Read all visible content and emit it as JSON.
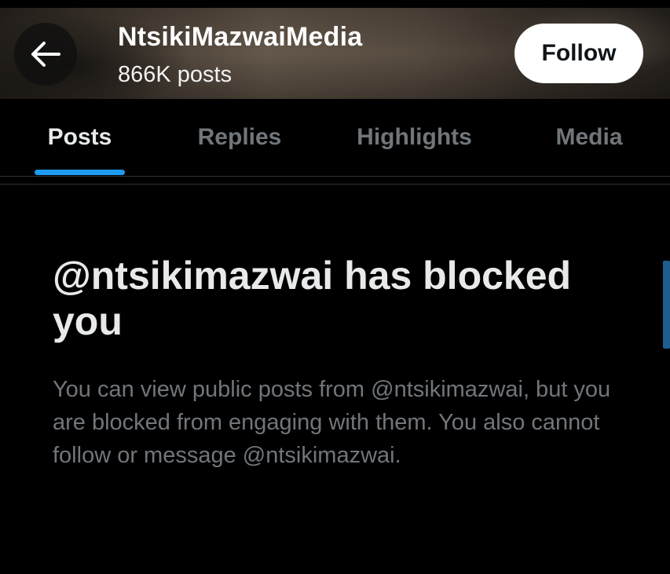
{
  "header": {
    "back_icon": "arrow-left-icon",
    "profile_name": "NtsikiMazwaiMedia",
    "post_count": "866K posts",
    "follow_label": "Follow"
  },
  "tabs": {
    "items": [
      {
        "label": "Posts",
        "active": true
      },
      {
        "label": "Replies",
        "active": false
      },
      {
        "label": "Highlights",
        "active": false
      },
      {
        "label": "Media",
        "active": false
      }
    ]
  },
  "blocked": {
    "title": "@ntsikimazwai has blocked you",
    "description": "You can view public posts from @ntsikimazwai, but you are blocked from engaging with them. You also cannot follow or message @ntsikimazwai."
  },
  "colors": {
    "background": "#000000",
    "accent": "#1d9bf0",
    "text_primary": "#e7e9ea",
    "text_secondary": "#71767b",
    "follow_button_bg": "#ffffff"
  }
}
